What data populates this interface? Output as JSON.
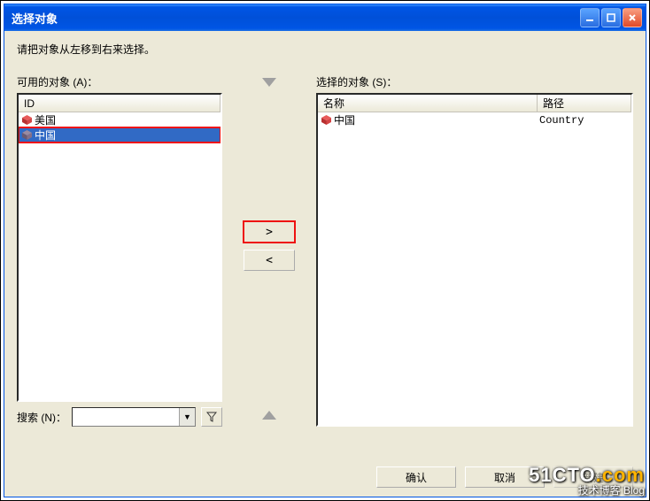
{
  "window": {
    "title": "选择对象"
  },
  "instruction": "请把对象从左移到右来选择。",
  "available": {
    "label": "可用的对象 (A)：",
    "header": "ID",
    "items": [
      {
        "icon": "cube-icon",
        "label": "美国",
        "selected": false
      },
      {
        "icon": "cube-icon",
        "label": "中国",
        "selected": true
      }
    ]
  },
  "selected": {
    "label": "选择的对象 (S)：",
    "headers": {
      "name": "名称",
      "path": "路径"
    },
    "items": [
      {
        "icon": "cube-icon",
        "name": "中国",
        "path": "Country"
      }
    ]
  },
  "move": {
    "right": ">",
    "left": "<"
  },
  "search": {
    "label": "搜索 (N)："
  },
  "buttons": {
    "ok": "确认",
    "cancel": "取消",
    "new": "新建"
  },
  "watermark": {
    "line1a": "51CTO",
    "line1b": ".com",
    "line2": "技术博客 Blog"
  }
}
